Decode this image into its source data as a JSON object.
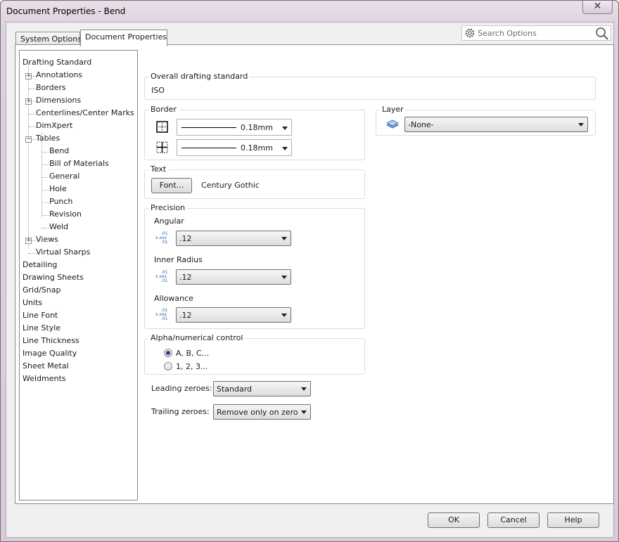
{
  "window": {
    "title": "Document Properties - Bend",
    "close_glyph": "✕"
  },
  "tabs": [
    {
      "label": "System Options",
      "active": false
    },
    {
      "label": "Document Properties",
      "active": true
    }
  ],
  "search": {
    "placeholder": "Search Options"
  },
  "tree": {
    "items": [
      {
        "label": "Drafting Standard"
      },
      {
        "label": "Annotations",
        "expander": "+"
      },
      {
        "label": "Borders"
      },
      {
        "label": "Dimensions",
        "expander": "+"
      },
      {
        "label": "Centerlines/Center Marks"
      },
      {
        "label": "DimXpert"
      },
      {
        "label": "Tables",
        "expander": "−"
      },
      {
        "label": "Bend",
        "selected": true
      },
      {
        "label": "Bill of Materials"
      },
      {
        "label": "General"
      },
      {
        "label": "Hole"
      },
      {
        "label": "Punch"
      },
      {
        "label": "Revision"
      },
      {
        "label": "Weld"
      },
      {
        "label": "Views",
        "expander": "+"
      },
      {
        "label": "Virtual Sharps"
      },
      {
        "label": "Detailing"
      },
      {
        "label": "Drawing Sheets"
      },
      {
        "label": "Grid/Snap"
      },
      {
        "label": "Units"
      },
      {
        "label": "Line Font"
      },
      {
        "label": "Line Style"
      },
      {
        "label": "Line Thickness"
      },
      {
        "label": "Image Quality"
      },
      {
        "label": "Sheet Metal"
      },
      {
        "label": "Weldments"
      }
    ]
  },
  "overall": {
    "label": "Overall drafting standard",
    "value": "ISO"
  },
  "border": {
    "label": "Border",
    "outer_thickness": "0.18mm",
    "inner_thickness": "0.18mm"
  },
  "layer": {
    "label": "Layer",
    "value": "-None-"
  },
  "text": {
    "label": "Text",
    "font_button": "Font...",
    "font_name": "Century Gothic"
  },
  "precision": {
    "label": "Precision",
    "icon_text": [
      ".01",
      "x.xxx",
      ".01"
    ],
    "angular": {
      "label": "Angular",
      "value": ".12"
    },
    "inner_radius": {
      "label": "Inner Radius",
      "value": ".12"
    },
    "allowance": {
      "label": "Allowance",
      "value": ".12"
    }
  },
  "alpha": {
    "label": "Alpha/numerical control",
    "options": [
      {
        "label": "A, B, C...",
        "selected": true
      },
      {
        "label": "1, 2, 3...",
        "selected": false
      }
    ]
  },
  "zeroes": {
    "leading_label": "Leading zeroes:",
    "leading_value": "Standard",
    "trailing_label": "Trailing zeroes:",
    "trailing_value": "Remove only on zero"
  },
  "buttons": {
    "ok": "OK",
    "cancel": "Cancel",
    "help": "Help"
  },
  "colors": {
    "accent": "#2a5da8",
    "window_frame": "#ded0de",
    "group_border": "#dcdcdc"
  }
}
